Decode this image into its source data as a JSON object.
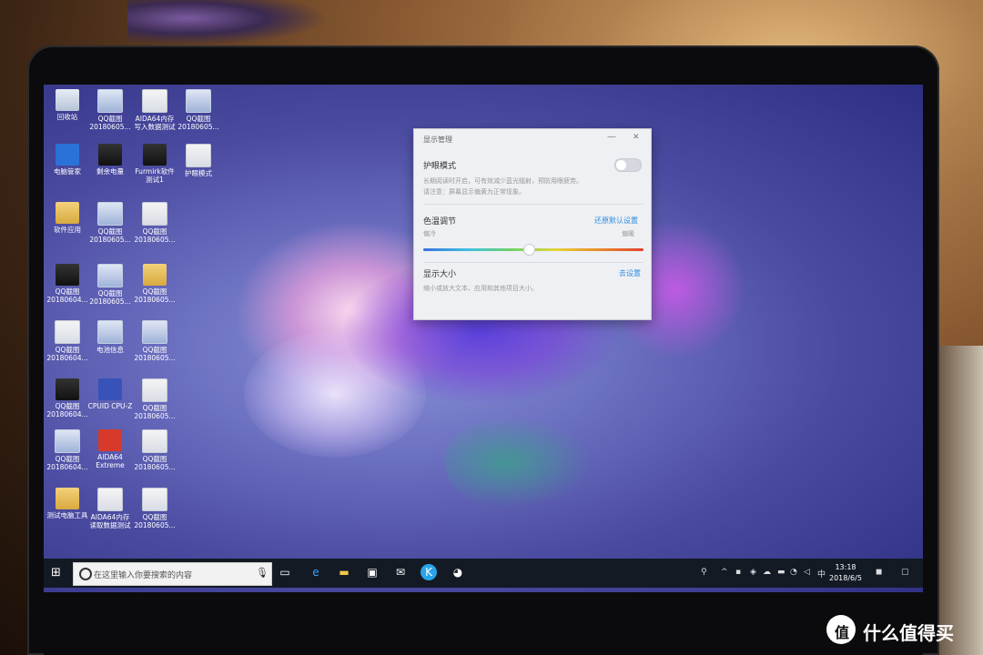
{
  "desktop": {
    "icons": [
      {
        "label": "回收站",
        "kind": "bin"
      },
      {
        "label": "QQ截图 20180605...",
        "kind": "shot"
      },
      {
        "label": "AIDA64内存 写入数据测试",
        "kind": "doc"
      },
      {
        "label": "QQ截图 20180605...",
        "kind": "shot"
      },
      {
        "label": "电脑管家",
        "kind": "blue"
      },
      {
        "label": "剩余电量",
        "kind": "dark"
      },
      {
        "label": "Furmirk软件 测试1",
        "kind": "dark"
      },
      {
        "label": "护眼模式",
        "kind": "doc"
      },
      {
        "label": "软件应用",
        "kind": "folder"
      },
      {
        "label": "QQ截图 20180605...",
        "kind": "shot"
      },
      {
        "label": "QQ截图 20180605...",
        "kind": "doc"
      },
      {
        "label": "QQ截图 20180604...",
        "kind": "dark"
      },
      {
        "label": "QQ截图 20180605...",
        "kind": "shot"
      },
      {
        "label": "QQ截图 20180605...",
        "kind": "folder"
      },
      {
        "label": "QQ截图 20180604...",
        "kind": "doc"
      },
      {
        "label": "电池信息",
        "kind": "shot"
      },
      {
        "label": "QQ截图 20180605...",
        "kind": "shot"
      },
      {
        "label": "QQ截图 20180604...",
        "kind": "dark"
      },
      {
        "label": "CPUID CPU-Z",
        "kind": "cpu"
      },
      {
        "label": "QQ截图 20180605...",
        "kind": "doc"
      },
      {
        "label": "QQ截图 20180604...",
        "kind": "shot"
      },
      {
        "label": "AIDA64 Extreme",
        "kind": "aida"
      },
      {
        "label": "QQ截图 20180605...",
        "kind": "doc"
      },
      {
        "label": "测试电脑工具",
        "kind": "folder"
      },
      {
        "label": "AIDA64内存 读取数据测试",
        "kind": "doc"
      },
      {
        "label": "QQ截图 20180605...",
        "kind": "doc"
      }
    ]
  },
  "dialog": {
    "title": "显示管理",
    "minimize_glyph": "—",
    "close_glyph": "✕",
    "eye_mode": {
      "title": "护眼模式",
      "desc_line1": "长期阅读时开启，可有效减少蓝光辐射，预防用眼疲劳。",
      "desc_line2": "请注意：屏幕显示偏黄为正常现象。",
      "enabled": false
    },
    "color_temp": {
      "title": "色温调节",
      "reset_link": "还原默认设置",
      "cold_label": "偏冷",
      "warm_label": "偏暖",
      "level": 0.48
    },
    "display_size": {
      "title": "显示大小",
      "link": "去设置",
      "desc": "缩小或放大文本、应用和其他项目大小。"
    }
  },
  "taskbar": {
    "start_icon": "windows-icon",
    "search_placeholder": "在这里输入你要搜索的内容",
    "clock_time": "13:18",
    "clock_date": "2018/6/5",
    "ime": "中"
  },
  "watermark": {
    "logo": "值",
    "text": "什么值得买"
  }
}
